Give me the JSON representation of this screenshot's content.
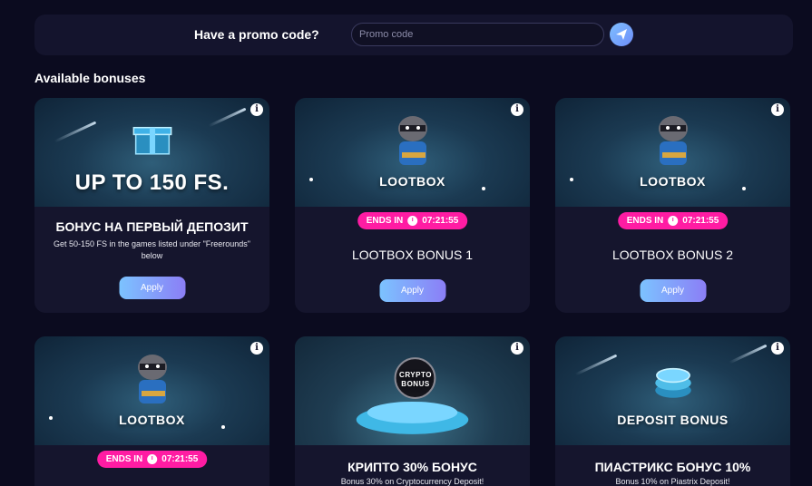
{
  "promo": {
    "label": "Have a promo code?",
    "placeholder": "Promo code",
    "submit_icon": "send-arrow-icon"
  },
  "section_title": "Available bonuses",
  "cards": [
    {
      "banner_text": "UP TO 150 FS.",
      "title": "БОНУС НА ПЕРВЫЙ ДЕПОЗИТ",
      "description": "Get 50-150 FS in the games listed under \"Freerounds\" below",
      "button": "Apply",
      "art": "gift-box-icon"
    },
    {
      "banner_text": "LOOTBOX",
      "ends_label": "ENDS IN",
      "ends_time": "07:21:55",
      "title": "LOOTBOX BONUS 1",
      "button": "Apply",
      "art": "raccoon-icon"
    },
    {
      "banner_text": "LOOTBOX",
      "ends_label": "ENDS IN",
      "ends_time": "07:21:55",
      "title": "LOOTBOX BONUS 2",
      "button": "Apply",
      "art": "raccoon-icon"
    },
    {
      "banner_text": "LOOTBOX",
      "ends_label": "ENDS IN",
      "ends_time": "07:21:55",
      "art": "raccoon-icon"
    },
    {
      "banner_text": "CRYPTO BONUS",
      "title": "КРИПТО 30% БОНУС",
      "description": "Bonus 30% on Cryptocurrency Deposit!",
      "art": "crypto-coins-icon"
    },
    {
      "banner_text": "DEPOSIT BONUS",
      "title": "ПИАСТРИКС БОНУС 10%",
      "description": "Bonus 10% on Piastrix Deposit!",
      "art": "coin-stack-icon"
    }
  ],
  "colors": {
    "background": "#0b0b1f",
    "card": "#15152d",
    "badge": "#ff1ca3",
    "button_from": "#7cc3ff",
    "button_to": "#8b7ef6"
  }
}
